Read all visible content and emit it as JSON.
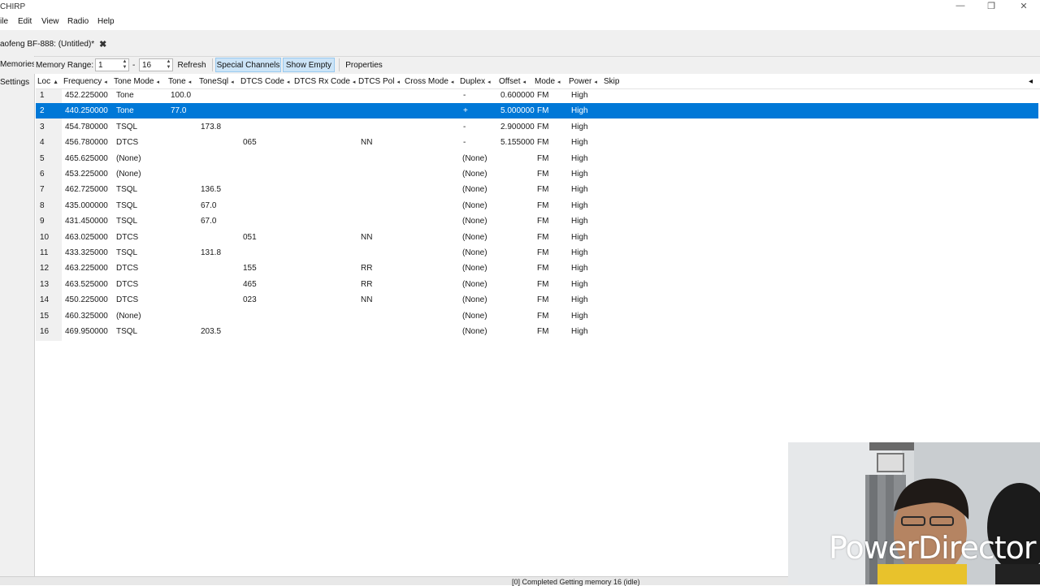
{
  "window": {
    "title": "CHIRP",
    "controls": [
      "—",
      "❐",
      "✕"
    ]
  },
  "menu": [
    "ile",
    "Edit",
    "View",
    "Radio",
    "Help"
  ],
  "tab": {
    "label": "aofeng BF-888: (Untitled)*"
  },
  "side_tabs": {
    "memories": "Memories",
    "settings": "Settings"
  },
  "toolbar": {
    "range_label": "Memory Range:",
    "range_start": "1",
    "range_dash": "-",
    "range_end": "16",
    "refresh": "Refresh",
    "special_channels": "Special Channels",
    "show_empty": "Show Empty",
    "properties": "Properties"
  },
  "columns": [
    "Loc",
    "Frequency",
    "Tone Mode",
    "Tone",
    "ToneSql",
    "DTCS Code",
    "DTCS Rx Code",
    "DTCS Pol",
    "Cross Mode",
    "Duplex",
    "Offset",
    "Mode",
    "Power",
    "Skip"
  ],
  "rows": [
    {
      "loc": "1",
      "freq": "452.225000",
      "tmode": "Tone",
      "tone": "100.0",
      "tsql": "",
      "dtcs": "",
      "dpol": "",
      "duplex": "-",
      "offset": "0.600000",
      "mode": "FM",
      "power": "High"
    },
    {
      "loc": "2",
      "freq": "440.250000",
      "tmode": "Tone",
      "tone": "77.0",
      "tsql": "",
      "dtcs": "",
      "dpol": "",
      "duplex": "+",
      "offset": "5.000000",
      "mode": "FM",
      "power": "High"
    },
    {
      "loc": "3",
      "freq": "454.780000",
      "tmode": "TSQL",
      "tone": "",
      "tsql": "173.8",
      "dtcs": "",
      "dpol": "",
      "duplex": "-",
      "offset": "2.900000",
      "mode": "FM",
      "power": "High"
    },
    {
      "loc": "4",
      "freq": "456.780000",
      "tmode": "DTCS",
      "tone": "",
      "tsql": "",
      "dtcs": "065",
      "dpol": "NN",
      "duplex": "-",
      "offset": "5.155000",
      "mode": "FM",
      "power": "High"
    },
    {
      "loc": "5",
      "freq": "465.625000",
      "tmode": "(None)",
      "tone": "",
      "tsql": "",
      "dtcs": "",
      "dpol": "",
      "duplex": "(None)",
      "offset": "",
      "mode": "FM",
      "power": "High"
    },
    {
      "loc": "6",
      "freq": "453.225000",
      "tmode": "(None)",
      "tone": "",
      "tsql": "",
      "dtcs": "",
      "dpol": "",
      "duplex": "(None)",
      "offset": "",
      "mode": "FM",
      "power": "High"
    },
    {
      "loc": "7",
      "freq": "462.725000",
      "tmode": "TSQL",
      "tone": "",
      "tsql": "136.5",
      "dtcs": "",
      "dpol": "",
      "duplex": "(None)",
      "offset": "",
      "mode": "FM",
      "power": "High"
    },
    {
      "loc": "8",
      "freq": "435.000000",
      "tmode": "TSQL",
      "tone": "",
      "tsql": "67.0",
      "dtcs": "",
      "dpol": "",
      "duplex": "(None)",
      "offset": "",
      "mode": "FM",
      "power": "High"
    },
    {
      "loc": "9",
      "freq": "431.450000",
      "tmode": "TSQL",
      "tone": "",
      "tsql": "67.0",
      "dtcs": "",
      "dpol": "",
      "duplex": "(None)",
      "offset": "",
      "mode": "FM",
      "power": "High"
    },
    {
      "loc": "10",
      "freq": "463.025000",
      "tmode": "DTCS",
      "tone": "",
      "tsql": "",
      "dtcs": "051",
      "dpol": "NN",
      "duplex": "(None)",
      "offset": "",
      "mode": "FM",
      "power": "High"
    },
    {
      "loc": "11",
      "freq": "433.325000",
      "tmode": "TSQL",
      "tone": "",
      "tsql": "131.8",
      "dtcs": "",
      "dpol": "",
      "duplex": "(None)",
      "offset": "",
      "mode": "FM",
      "power": "High"
    },
    {
      "loc": "12",
      "freq": "463.225000",
      "tmode": "DTCS",
      "tone": "",
      "tsql": "",
      "dtcs": "155",
      "dpol": "RR",
      "duplex": "(None)",
      "offset": "",
      "mode": "FM",
      "power": "High"
    },
    {
      "loc": "13",
      "freq": "463.525000",
      "tmode": "DTCS",
      "tone": "",
      "tsql": "",
      "dtcs": "465",
      "dpol": "RR",
      "duplex": "(None)",
      "offset": "",
      "mode": "FM",
      "power": "High"
    },
    {
      "loc": "14",
      "freq": "450.225000",
      "tmode": "DTCS",
      "tone": "",
      "tsql": "",
      "dtcs": "023",
      "dpol": "NN",
      "duplex": "(None)",
      "offset": "",
      "mode": "FM",
      "power": "High"
    },
    {
      "loc": "15",
      "freq": "460.325000",
      "tmode": "(None)",
      "tone": "",
      "tsql": "",
      "dtcs": "",
      "dpol": "",
      "duplex": "(None)",
      "offset": "",
      "mode": "FM",
      "power": "High"
    },
    {
      "loc": "16",
      "freq": "469.950000",
      "tmode": "TSQL",
      "tone": "",
      "tsql": "203.5",
      "dtcs": "",
      "dpol": "",
      "duplex": "(None)",
      "offset": "",
      "mode": "FM",
      "power": "High"
    }
  ],
  "selected_loc": "2",
  "status": "[0] Completed Getting memory 16 (idle)",
  "overlay_watermark": "PowerDirector",
  "colors": {
    "selection": "#0078d7",
    "toggle_bg": "#cce4f7",
    "panel_bg": "#f0f0f0"
  }
}
